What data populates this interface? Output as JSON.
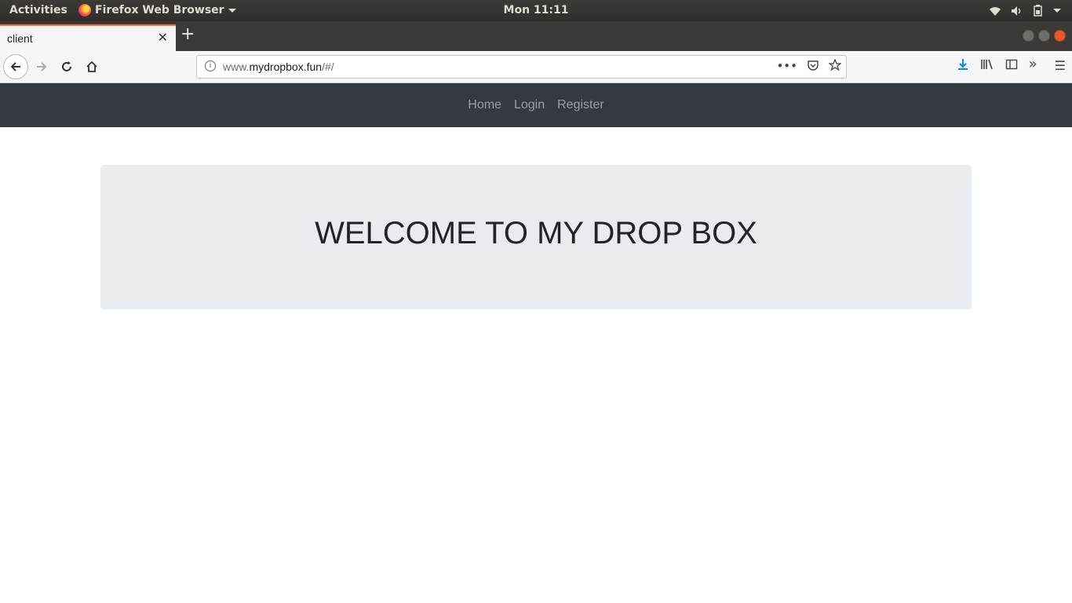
{
  "os": {
    "activities": "Activities",
    "app_name": "Firefox Web Browser",
    "clock": "Mon 11:11"
  },
  "browser": {
    "tab_title": "client",
    "url_prefix": "www.",
    "url_domain": "mydropbox.fun",
    "url_path": "/#/"
  },
  "site": {
    "nav": [
      "Home",
      "Login",
      "Register"
    ],
    "heading": "WELCOME TO MY DROP BOX"
  }
}
